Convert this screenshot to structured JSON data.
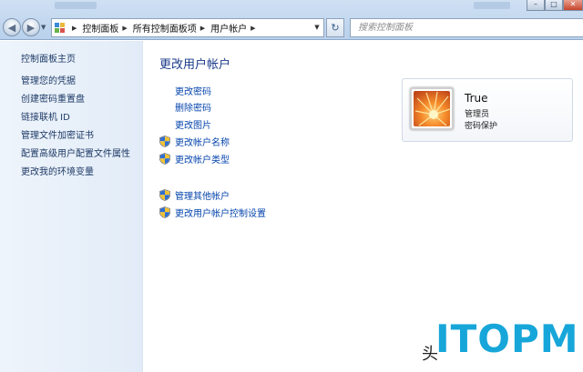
{
  "address_bar": {
    "breadcrumbs": [
      "控制面板",
      "所有控制面板项",
      "用户帐户"
    ]
  },
  "search": {
    "placeholder": "搜索控制面板"
  },
  "sidebar": {
    "home": "控制面板主页",
    "items": [
      "管理您的凭据",
      "创建密码重置盘",
      "链接联机 ID",
      "管理文件加密证书",
      "配置高级用户配置文件属性",
      "更改我的环境变量"
    ]
  },
  "main": {
    "heading": "更改用户帐户",
    "actions": [
      {
        "label": "更改密码",
        "shield": false
      },
      {
        "label": "删除密码",
        "shield": false
      },
      {
        "label": "更改图片",
        "shield": false
      },
      {
        "label": "更改帐户名称",
        "shield": true
      },
      {
        "label": "更改帐户类型",
        "shield": true
      }
    ],
    "other_actions": [
      {
        "label": "管理其他帐户",
        "shield": true
      },
      {
        "label": "更改用户帐户控制设置",
        "shield": true
      }
    ]
  },
  "account": {
    "name": "True",
    "role": "管理员",
    "status": "密码保护"
  },
  "watermark": {
    "char": "头",
    "logo": "ITOPM"
  },
  "colors": {
    "link": "#0645ad",
    "heading": "#1a3a8a",
    "logo": "#17a6d9"
  },
  "icons": [
    "back-arrow-icon",
    "forward-arrow-icon",
    "control-panel-icon",
    "refresh-icon",
    "uac-shield-icon",
    "flower-user-picture"
  ]
}
